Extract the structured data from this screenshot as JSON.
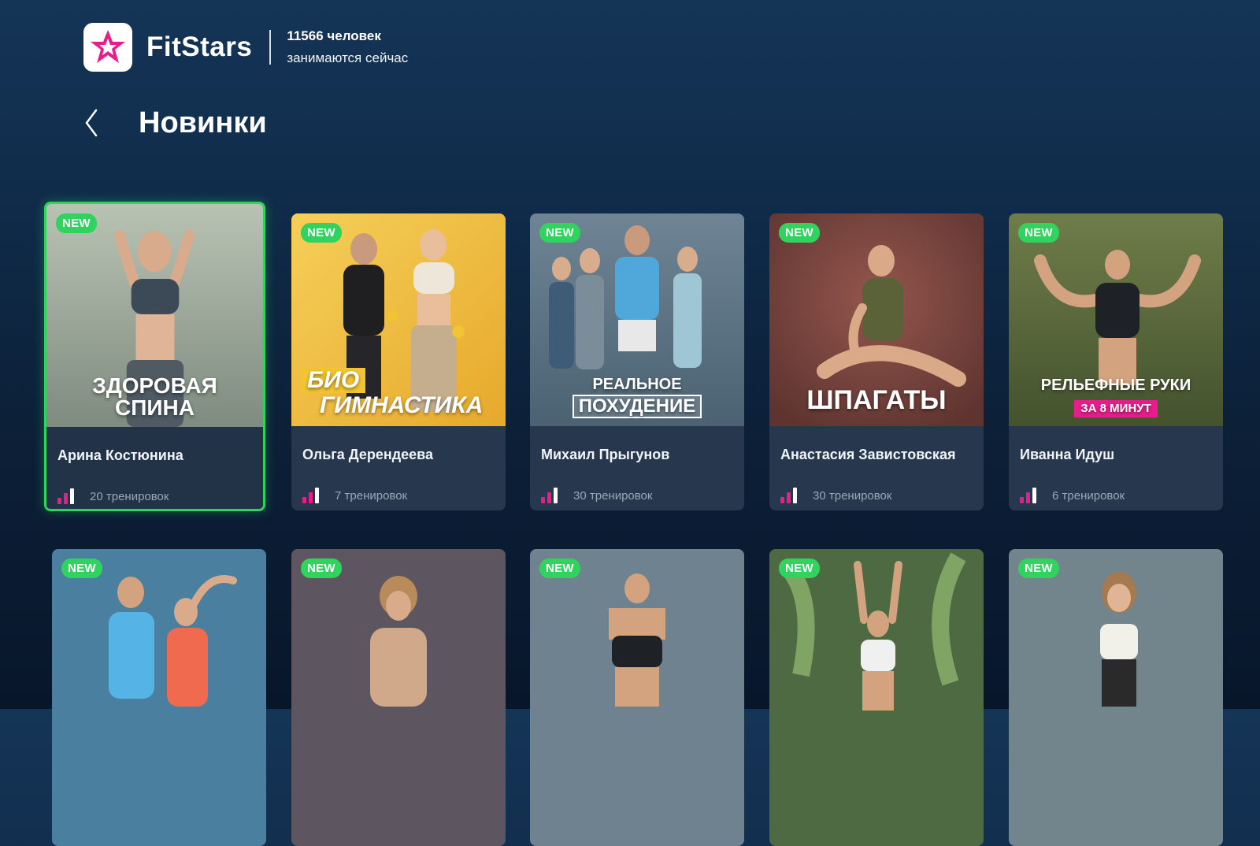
{
  "header": {
    "brand": "FitStars",
    "online_count": "11566 человек",
    "online_label": "занимаются сейчас"
  },
  "page": {
    "title": "Новинки"
  },
  "badge_label": "NEW",
  "colors": {
    "accent_green": "#2fd35e",
    "logo_pink": "#e81d8c",
    "level_bar_pink": "#e81d8c",
    "level_bar_white": "#ffffff"
  },
  "programs": [
    {
      "author": "Арина Костюнина",
      "workouts": "20 тренировок",
      "cover_lines": [
        "ЗДОРОВАЯ",
        "СПИНА"
      ],
      "focused": true
    },
    {
      "author": "Ольга Дерендеева",
      "workouts": "7 тренировок",
      "cover_lines": [
        "БИО",
        "ГИМНАСТИКА"
      ]
    },
    {
      "author": "Михаил Прыгунов",
      "workouts": "30 тренировок",
      "cover_lines": [
        "РЕАЛЬНОЕ",
        "ПОХУДЕНИЕ"
      ]
    },
    {
      "author": "Анастасия Завистовская",
      "workouts": "30 тренировок",
      "cover_lines": [
        "ШПАГАТЫ"
      ]
    },
    {
      "author": "Иванна Идуш",
      "workouts": "6 тренировок",
      "cover_lines": [
        "РЕЛЬЕФНЫЕ РУКИ",
        "ЗА 8 МИНУТ"
      ]
    }
  ]
}
